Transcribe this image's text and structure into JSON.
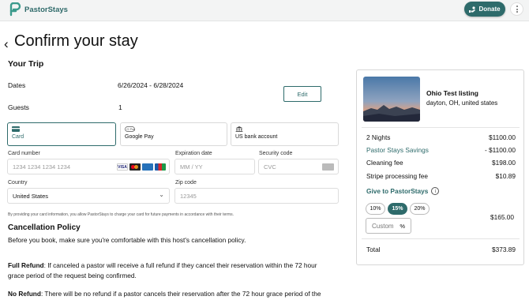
{
  "header": {
    "brand": "PastorStays",
    "donate_label": "Donate"
  },
  "page": {
    "title": "Confirm your stay"
  },
  "trip": {
    "heading": "Your Trip",
    "dates_label": "Dates",
    "dates_value": "6/26/2024 - 6/28/2024",
    "guests_label": "Guests",
    "guests_value": "1",
    "edit_label": "Edit"
  },
  "payment": {
    "methods": [
      {
        "label": "Card",
        "icon": "card-icon",
        "selected": true
      },
      {
        "label": "Google Pay",
        "icon": "google-pay-icon",
        "selected": false
      },
      {
        "label": "US bank account",
        "icon": "bank-icon",
        "selected": false
      }
    ],
    "card_number_label": "Card number",
    "card_number_placeholder": "1234 1234 1234 1234",
    "card_brands": [
      "visa",
      "mastercard",
      "amex",
      "jcb"
    ],
    "expiration_label": "Expiration date",
    "expiration_placeholder": "MM / YY",
    "security_label": "Security code",
    "security_placeholder": "CVC",
    "country_label": "Country",
    "country_value": "United States",
    "zip_label": "Zip code",
    "zip_placeholder": "12345",
    "disclaimer": "By providing your card information, you allow PastorStays to charge your card for future payments in accordance with their terms."
  },
  "cancellation": {
    "heading": "Cancellation Policy",
    "intro": "Before you book, make sure you're comfortable with this host's cancellation policy.",
    "full_refund_title": "Full Refund",
    "full_refund_line1": ": If canceled a pastor will receive a full refund if they cancel their reservation within the 72 hour",
    "full_refund_line2": "grace period of the request being confirmed.",
    "no_refund_title": "No Refund",
    "no_refund_line1": ": There will be no refund if a pastor cancels their reservation after the 72 hour grace period of the"
  },
  "summary": {
    "listing_name": "Ohio Test listing",
    "listing_location": "dayton, OH, united states",
    "nights_label": "2 Nights",
    "nights_amount": "$1100.00",
    "savings_label": "Pastor Stays Savings",
    "savings_amount": "- $1100.00",
    "cleaning_label": "Cleaning fee",
    "cleaning_amount": "$198.00",
    "stripe_label": "Stripe processing fee",
    "stripe_amount": "$10.89",
    "give_label": "Give to PastorStays",
    "give_options": [
      "10%",
      "15%",
      "20%"
    ],
    "give_selected": "15%",
    "custom_placeholder": "Custom",
    "custom_suffix": "%",
    "give_amount": "$165.00",
    "total_label": "Total",
    "total_amount": "$373.89"
  },
  "colors": {
    "brand": "#2e6b6b"
  }
}
